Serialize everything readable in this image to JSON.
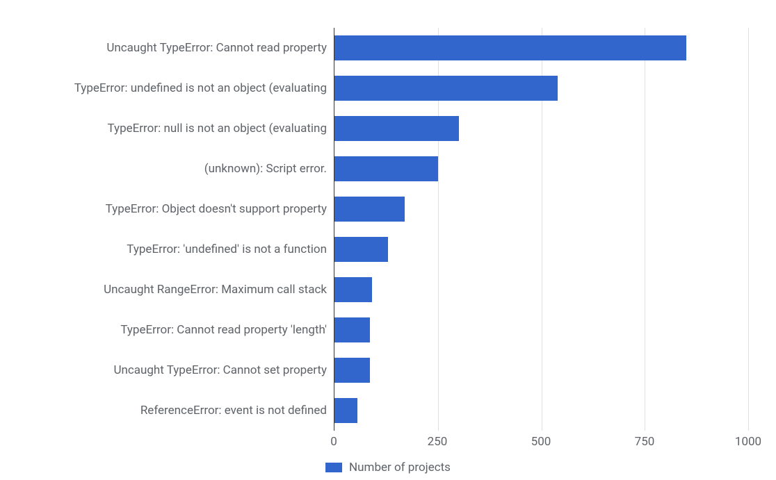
{
  "chart_data": {
    "type": "bar",
    "orientation": "horizontal",
    "categories": [
      "Uncaught TypeError: Cannot read property",
      "TypeError: undefined is not an object (evaluating",
      "TypeError: null is not an object (evaluating",
      "(unknown): Script error.",
      "TypeError: Object doesn't support property",
      "TypeError: 'undefined' is not a function",
      "Uncaught RangeError: Maximum call stack",
      "TypeError: Cannot read property 'length'",
      "Uncaught TypeError: Cannot set property",
      "ReferenceError: event is not defined"
    ],
    "values": [
      850,
      540,
      300,
      250,
      170,
      130,
      90,
      85,
      85,
      55
    ],
    "x_ticks": [
      0,
      250,
      500,
      750,
      1000
    ],
    "xlim": [
      0,
      1000
    ],
    "series_name": "Number of projects",
    "bar_color": "#3366cc"
  },
  "legend": {
    "label": "Number of projects"
  }
}
